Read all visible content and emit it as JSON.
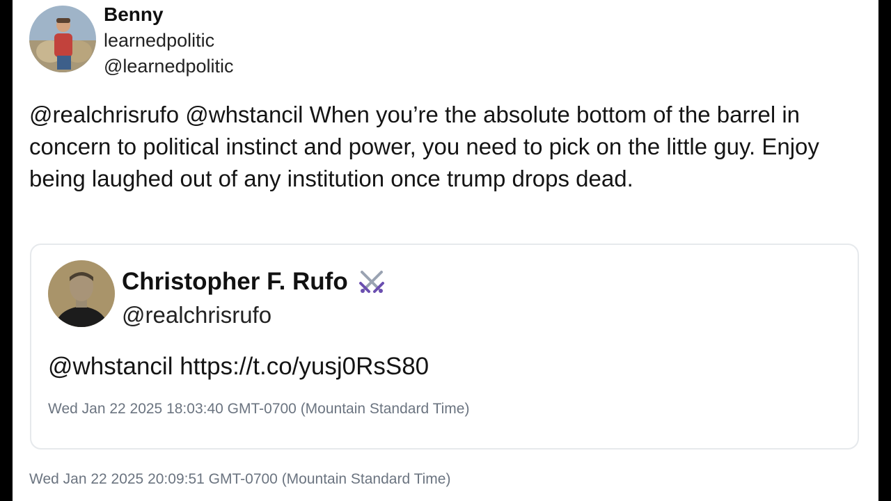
{
  "author": {
    "display_name": "Benny",
    "sub_name": "learnedpolitic",
    "handle": "@learnedpolitic"
  },
  "tweet": {
    "text": "@realchrisrufo @whstancil When you’re the absolute bottom of the barrel in concern to political instinct and power, you need to pick on the little guy. Enjoy being laughed out of any institution once trump drops dead.",
    "timestamp": "Wed Jan 22 2025 20:09:51 GMT-0700 (Mountain Standard Time)"
  },
  "quoted_tweet": {
    "display_name": "Christopher F. Rufo",
    "badge_icon": "crossed-swords-icon",
    "handle": "@realchrisrufo",
    "text": "@whstancil https://t.co/yusj0RsS80",
    "timestamp": "Wed Jan 22 2025 18:03:40 GMT-0700 (Mountain Standard Time)"
  },
  "colors": {
    "background": "#ffffff",
    "frame": "#000000",
    "text": "#141414",
    "muted": "#6b7480",
    "card_border": "#e6e9ec"
  }
}
